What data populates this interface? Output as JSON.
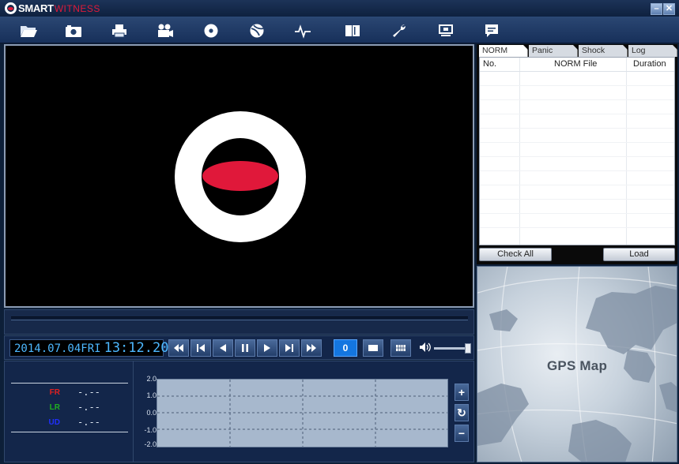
{
  "titlebar": {
    "logo_primary": "SMART",
    "logo_secondary": "WITNESS",
    "minimize_label": "–",
    "close_label": "✕"
  },
  "toolbar": {
    "tools": [
      {
        "icon": "folder-open-icon"
      },
      {
        "icon": "camera-icon"
      },
      {
        "icon": "printer-icon"
      },
      {
        "icon": "video-camera-icon"
      },
      {
        "icon": "disc-icon"
      },
      {
        "icon": "globe-icon"
      },
      {
        "icon": "pulse-icon"
      },
      {
        "icon": "book-icon"
      },
      {
        "icon": "wrench-icon"
      },
      {
        "icon": "monitor-icon"
      },
      {
        "icon": "chat-icon"
      }
    ]
  },
  "player": {
    "date": "2014.07.04FRI",
    "time": "13:12.20",
    "speed": "0"
  },
  "gsensor": {
    "rows": [
      {
        "label": "FR",
        "value": "-.--",
        "color": "#e02020"
      },
      {
        "label": "LR",
        "value": "-.--",
        "color": "#20b020"
      },
      {
        "label": "UD",
        "value": "-.--",
        "color": "#2030ff"
      }
    ],
    "y_ticks": [
      "2.0",
      "1.0",
      "0.0",
      "-1.0",
      "-2.0"
    ],
    "zoom_in": "+",
    "reset": "↻",
    "zoom_out": "−"
  },
  "files": {
    "tabs": [
      "NORM",
      "Panic",
      "Shock",
      "Log"
    ],
    "active_tab": "NORM",
    "columns": [
      "No.",
      "NORM File",
      "Duration"
    ],
    "check_all_label": "Check All",
    "load_label": "Load"
  },
  "gps": {
    "label": "GPS Map"
  }
}
